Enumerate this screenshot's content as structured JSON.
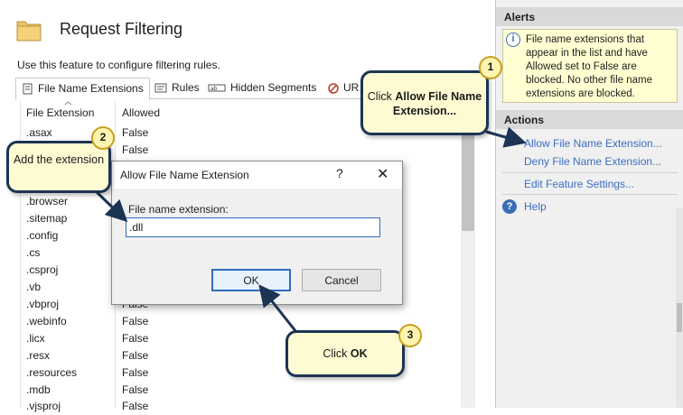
{
  "page": {
    "title": "Request Filtering",
    "description": "Use this feature to configure filtering rules."
  },
  "tabs": [
    {
      "label": "File Name Extensions",
      "icon": "file-extensions-icon",
      "active": true
    },
    {
      "label": "Rules",
      "icon": "rules-icon"
    },
    {
      "label": "Hidden Segments",
      "icon": "hidden-segments-icon"
    },
    {
      "label": "UR",
      "icon": "url-icon"
    }
  ],
  "grid": {
    "headers": [
      "File Extension",
      "Allowed"
    ],
    "rows": [
      {
        "ext": ".asax",
        "allowed": "False"
      },
      {
        "ext": "",
        "allowed": "False"
      },
      {
        "ext": "",
        "allowed": ""
      },
      {
        "ext": "",
        "allowed": ""
      },
      {
        "ext": ".browser",
        "allowed": ""
      },
      {
        "ext": ".sitemap",
        "allowed": ""
      },
      {
        "ext": ".config",
        "allowed": ""
      },
      {
        "ext": ".cs",
        "allowed": ""
      },
      {
        "ext": ".csproj",
        "allowed": ""
      },
      {
        "ext": ".vb",
        "allowed": ""
      },
      {
        "ext": ".vbproj",
        "allowed": "False"
      },
      {
        "ext": ".webinfo",
        "allowed": "False"
      },
      {
        "ext": ".licx",
        "allowed": "False"
      },
      {
        "ext": ".resx",
        "allowed": "False"
      },
      {
        "ext": ".resources",
        "allowed": "False"
      },
      {
        "ext": ".mdb",
        "allowed": "False"
      },
      {
        "ext": ".vjsproj",
        "allowed": "False"
      }
    ]
  },
  "alerts": {
    "heading": "Alerts",
    "text": "File name extensions that appear in the list and have Allowed set to False are blocked. No other file name extensions are blocked."
  },
  "actions": {
    "heading": "Actions",
    "allow": "Allow File Name Extension...",
    "deny": "Deny File Name Extension...",
    "edit": "Edit Feature Settings...",
    "help": "Help"
  },
  "dialog": {
    "title": "Allow File Name Extension",
    "help_glyph": "?",
    "close_glyph": "✕",
    "label": "File name extension:",
    "value": ".dll",
    "ok": "OK",
    "cancel": "Cancel"
  },
  "callouts": {
    "c1_prefix": "Click ",
    "c1_bold": "Allow File Name Extension...",
    "c1_badge": "1",
    "c2_text": "Add the extension",
    "c2_badge": "2",
    "c3_prefix": "Click ",
    "c3_bold": "OK",
    "c3_badge": "3"
  },
  "colors": {
    "callout_fill": "#fefbd2",
    "callout_border": "#1c3454",
    "link": "#3a6ec2",
    "alert_fill": "#ffffd2",
    "badge_fill": "#fff5b0"
  }
}
